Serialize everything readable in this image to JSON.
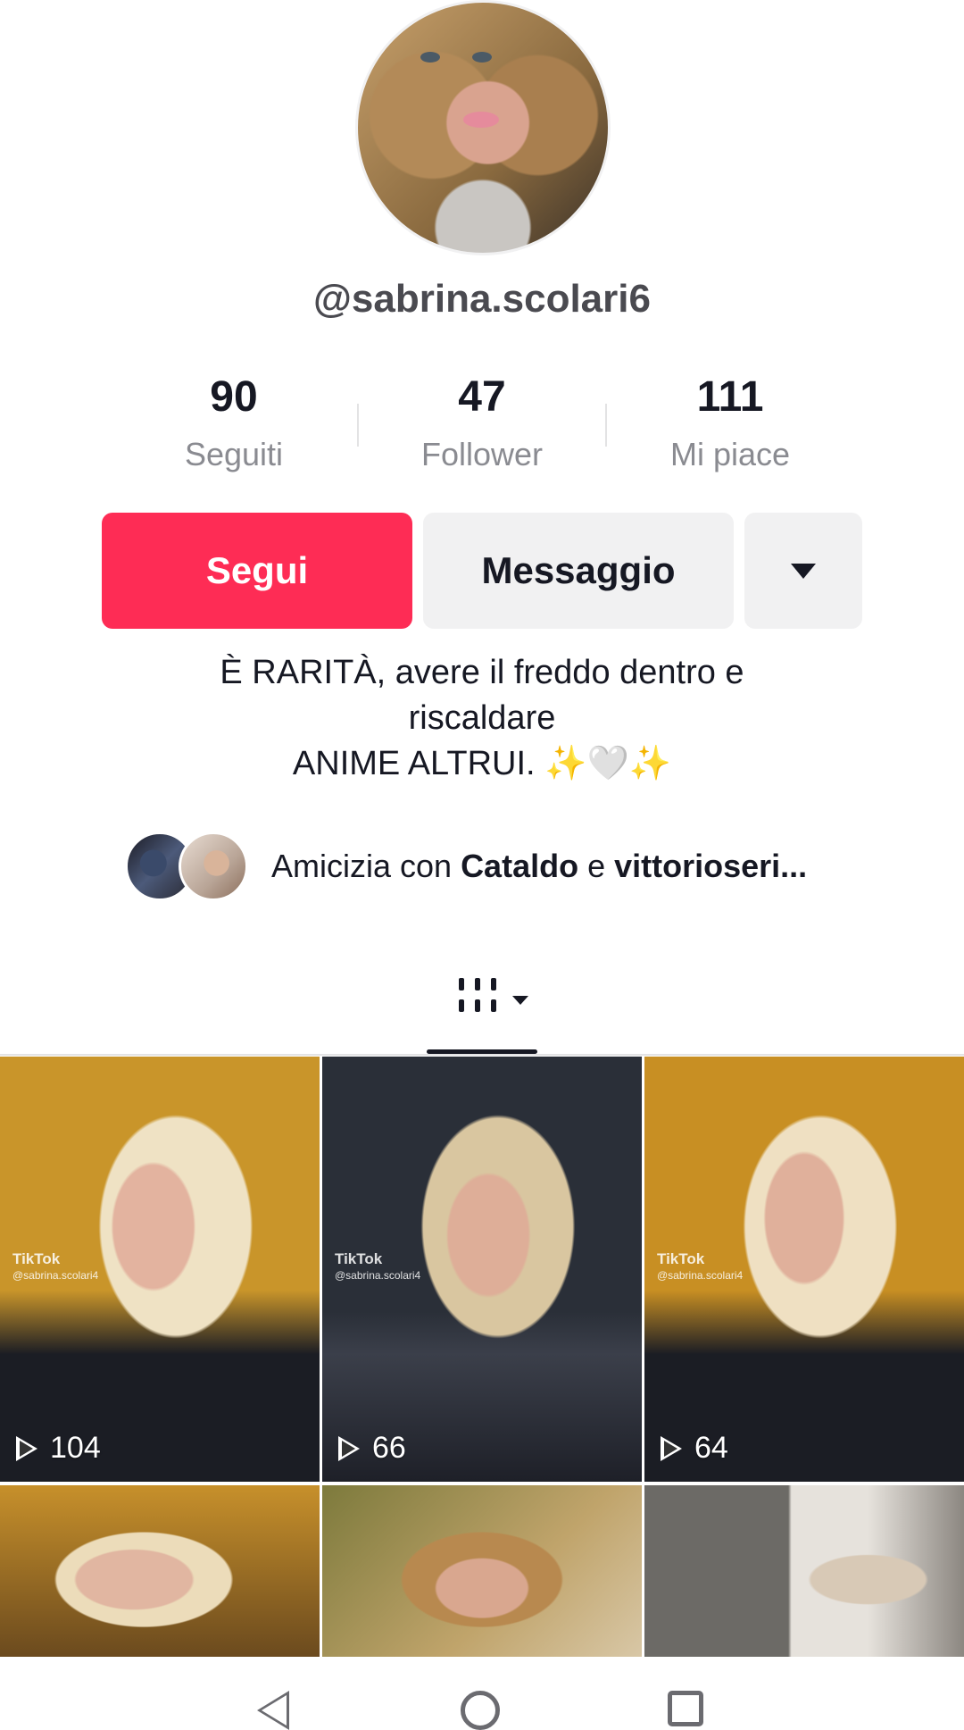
{
  "profile": {
    "username": "@sabrina.scolari6",
    "stats": [
      {
        "value": "90",
        "label": "Seguiti"
      },
      {
        "value": "47",
        "label": "Follower"
      },
      {
        "value": "111",
        "label": "Mi piace"
      }
    ]
  },
  "actions": {
    "follow_label": "Segui",
    "message_label": "Messaggio",
    "more_icon": "chevron-down-icon"
  },
  "bio": {
    "line1": "È RARITÀ, avere il freddo dentro e",
    "line2": "riscaldare",
    "line3": "ANIME ALTRUI. ✨🤍✨"
  },
  "friends": {
    "prefix": "Amicizia con ",
    "name1": "Cataldo",
    "joiner": " e ",
    "name2": "vittorioseri..."
  },
  "tabs": {
    "videos_icon": "grid-icon"
  },
  "videos": [
    {
      "views": "104",
      "watermark": "TikTok",
      "handle": "@sabrina.scolari4"
    },
    {
      "views": "66",
      "watermark": "TikTok",
      "handle": "@sabrina.scolari4"
    },
    {
      "views": "64",
      "watermark": "TikTok",
      "handle": "@sabrina.scolari4"
    },
    {
      "views": ""
    },
    {
      "views": ""
    },
    {
      "views": ""
    }
  ],
  "colors": {
    "accent": "#fe2c55",
    "secondary_button": "#f1f1f2",
    "text": "#161823",
    "muted": "#8a8b91"
  }
}
